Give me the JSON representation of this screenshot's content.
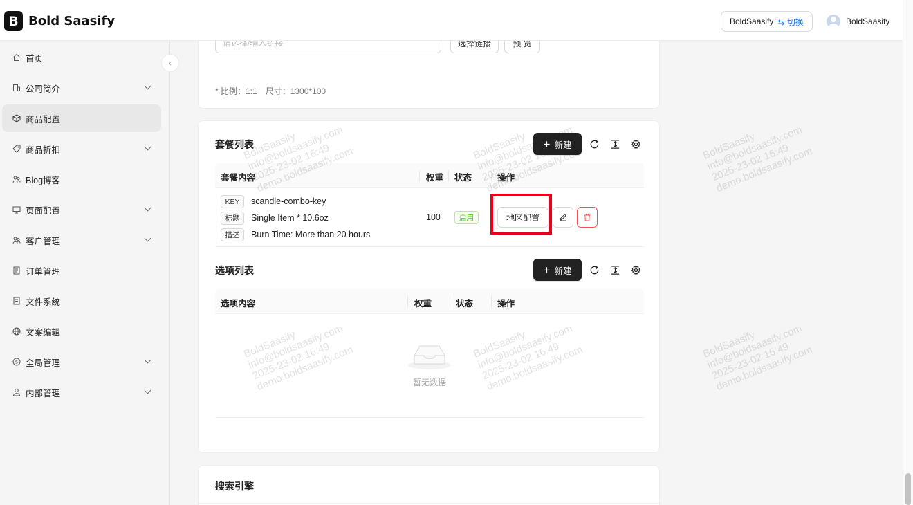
{
  "header": {
    "brand_letter": "B",
    "brand": "Bold Saasify",
    "org_name": "BoldSaasify",
    "switch_label": "⇆ 切换",
    "user_name": "BoldSaasify"
  },
  "sidebar": {
    "items": [
      {
        "label": "首页",
        "icon": "home-icon"
      },
      {
        "label": "公司简介",
        "icon": "building-icon"
      },
      {
        "label": "商品配置",
        "icon": "box-icon"
      },
      {
        "label": "商品折扣",
        "icon": "tag-icon"
      },
      {
        "label": "Blog博客",
        "icon": "users-icon"
      },
      {
        "label": "页面配置",
        "icon": "monitor-icon"
      },
      {
        "label": "客户管理",
        "icon": "team-icon"
      },
      {
        "label": "订单管理",
        "icon": "list-icon"
      },
      {
        "label": "文件系统",
        "icon": "file-icon"
      },
      {
        "label": "文案编辑",
        "icon": "globe-icon"
      },
      {
        "label": "全局管理",
        "icon": "dollar-icon"
      },
      {
        "label": "内部管理",
        "icon": "user-group-icon"
      }
    ],
    "collapse_glyph": "‹"
  },
  "top_card": {
    "link_placeholder": "请选择/输入链接",
    "select_link": "选择链接",
    "preview": "预 览",
    "ratio": "* 比例：1:1",
    "size": "尺寸：1300*100"
  },
  "package": {
    "title": "套餐列表",
    "new_label": "新建",
    "columns": {
      "content": "套餐内容",
      "weight": "权重",
      "status": "状态",
      "action": "操作"
    },
    "row": {
      "key_tag": "KEY",
      "key": "scandle-combo-key",
      "title_tag": "标题",
      "title": "Single Item * 10.6oz",
      "desc_tag": "描述",
      "desc": "Burn Time: More than 20 hours",
      "weight": "100",
      "status": "启用",
      "region_btn": "地区配置"
    }
  },
  "options": {
    "title": "选项列表",
    "new_label": "新建",
    "columns": {
      "content": "选项内容",
      "weight": "权重",
      "status": "状态",
      "action": "操作"
    },
    "empty": "暂无数据"
  },
  "seo": {
    "title": "搜索引擎"
  },
  "watermark": {
    "line1": "BoldSaasify",
    "line2": "info@boldsaasify.com",
    "line3": "2025-23-02 16:49",
    "line4": "demo.boldsaasify.com"
  },
  "colors": {
    "accent": "#1677ff",
    "highlight": "#e8001c",
    "success": "#52c41a",
    "danger": "#ff4d4f"
  }
}
